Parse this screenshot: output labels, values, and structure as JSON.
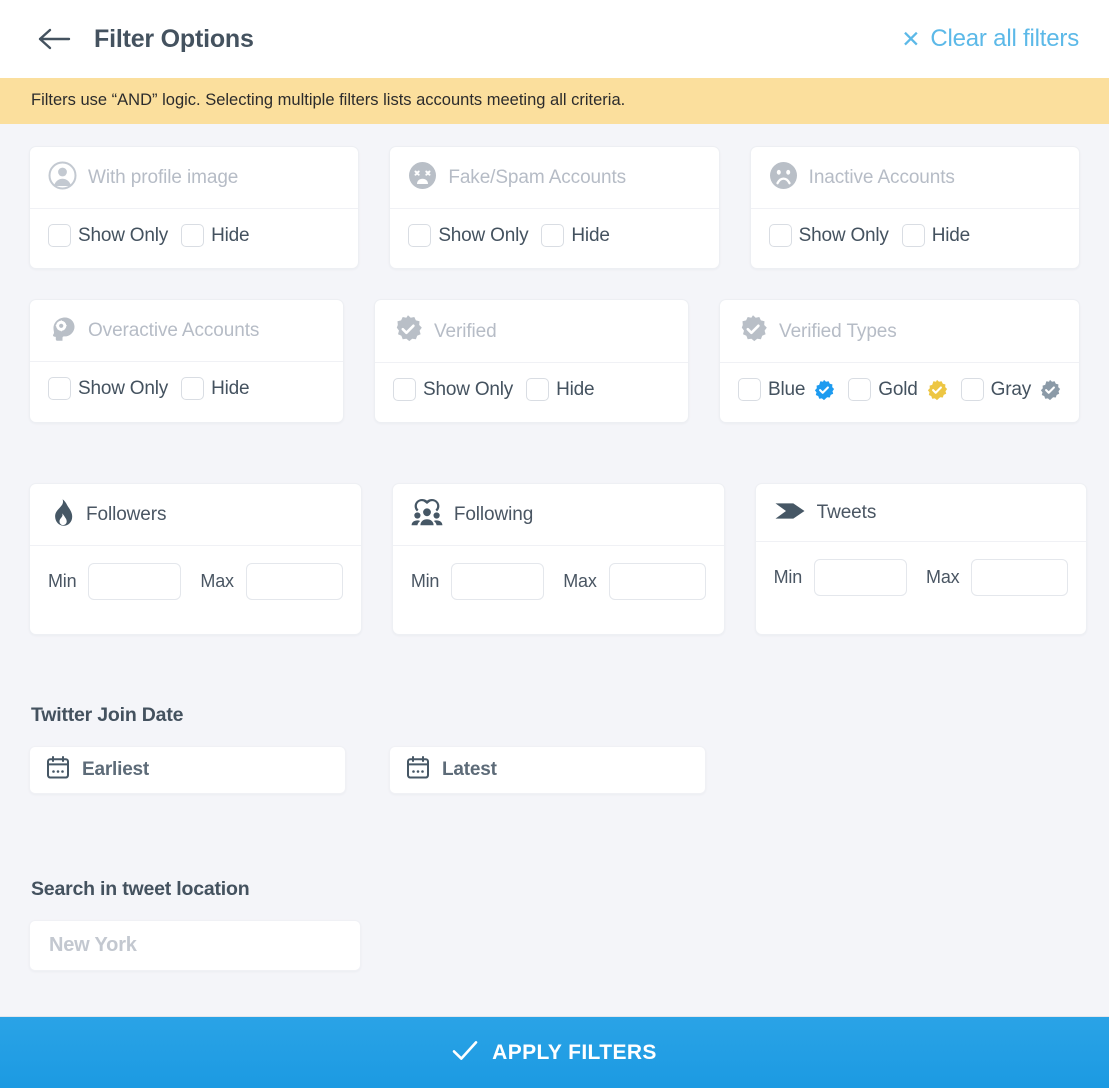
{
  "header": {
    "back_icon": "arrow-left-icon",
    "title": "Filter Options",
    "clear_icon": "close-x-icon",
    "clear_label": "Clear all filters",
    "accent_color": "#5cb9e8"
  },
  "notice": {
    "text": "Filters use “AND” logic. Selecting multiple filters lists accounts meeting all criteria.",
    "background_color": "#fbdf9d"
  },
  "toggle_filters": [
    {
      "icon": "profile-image-icon",
      "label": "With profile image",
      "options": [
        "Show Only",
        "Hide"
      ]
    },
    {
      "icon": "fake-spam-face-icon",
      "label": "Fake/Spam Accounts",
      "options": [
        "Show Only",
        "Hide"
      ]
    },
    {
      "icon": "sad-face-icon",
      "label": "Inactive Accounts",
      "options": [
        "Show Only",
        "Hide"
      ]
    },
    {
      "icon": "head-gear-icon",
      "label": "Overactive Accounts",
      "options": [
        "Show Only",
        "Hide"
      ]
    },
    {
      "icon": "verified-badge-icon",
      "label": "Verified",
      "options": [
        "Show Only",
        "Hide"
      ]
    }
  ],
  "verified_types": {
    "icon": "verified-badge-icon",
    "label": "Verified Types",
    "options": [
      {
        "label": "Blue",
        "badge_color": "#1d9bf0"
      },
      {
        "label": "Gold",
        "badge_color": "#edc643"
      },
      {
        "label": "Gray",
        "badge_color": "#8b9aa7"
      }
    ]
  },
  "range_filters": [
    {
      "icon": "flame-icon",
      "label": "Followers",
      "min_label": "Min",
      "max_label": "Max",
      "min_value": "",
      "max_value": ""
    },
    {
      "icon": "people-group-icon",
      "label": "Following",
      "min_label": "Min",
      "max_label": "Max",
      "min_value": "",
      "max_value": ""
    },
    {
      "icon": "send-arrow-icon",
      "label": "Tweets",
      "min_label": "Min",
      "max_label": "Max",
      "min_value": "",
      "max_value": ""
    }
  ],
  "join_date": {
    "section_title": "Twitter Join Date",
    "earliest": {
      "icon": "calendar-icon",
      "label": "Earliest"
    },
    "latest": {
      "icon": "calendar-icon",
      "label": "Latest"
    }
  },
  "location": {
    "section_title": "Search in tweet location",
    "placeholder": "New York",
    "value": ""
  },
  "apply": {
    "icon": "check-icon",
    "label": "APPLY FILTERS",
    "background_color": "#1c9ae2"
  }
}
